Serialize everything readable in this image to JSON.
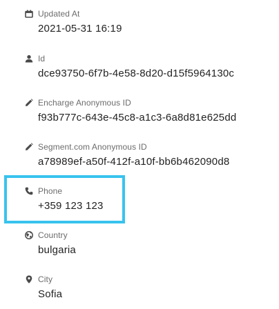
{
  "fields": [
    {
      "icon": "calendar-icon",
      "label": "Updated At",
      "value": "2021-05-31 16:19"
    },
    {
      "icon": "user-icon",
      "label": "Id",
      "value": "dce93750-6f7b-4e58-8d20-d15f5964130c"
    },
    {
      "icon": "pencil-icon",
      "label": "Encharge Anonymous ID",
      "value": "f93b777c-643e-45c8-a1c3-6a8d81e625dd"
    },
    {
      "icon": "pencil-icon",
      "label": "Segment.com Anonymous ID",
      "value": "a78989ef-a50f-412f-a10f-bb6b462090d8"
    },
    {
      "icon": "phone-icon",
      "label": "Phone",
      "value": "+359 123 123"
    },
    {
      "icon": "globe-icon",
      "label": "Country",
      "value": "bulgaria"
    },
    {
      "icon": "map-pin-icon",
      "label": "City",
      "value": "Sofia"
    }
  ],
  "highlight": {
    "target": "phone",
    "color": "#38c3ee"
  },
  "colors": {
    "label": "#6b6b6b",
    "value": "#222222",
    "icon": "#4a4a4a"
  }
}
